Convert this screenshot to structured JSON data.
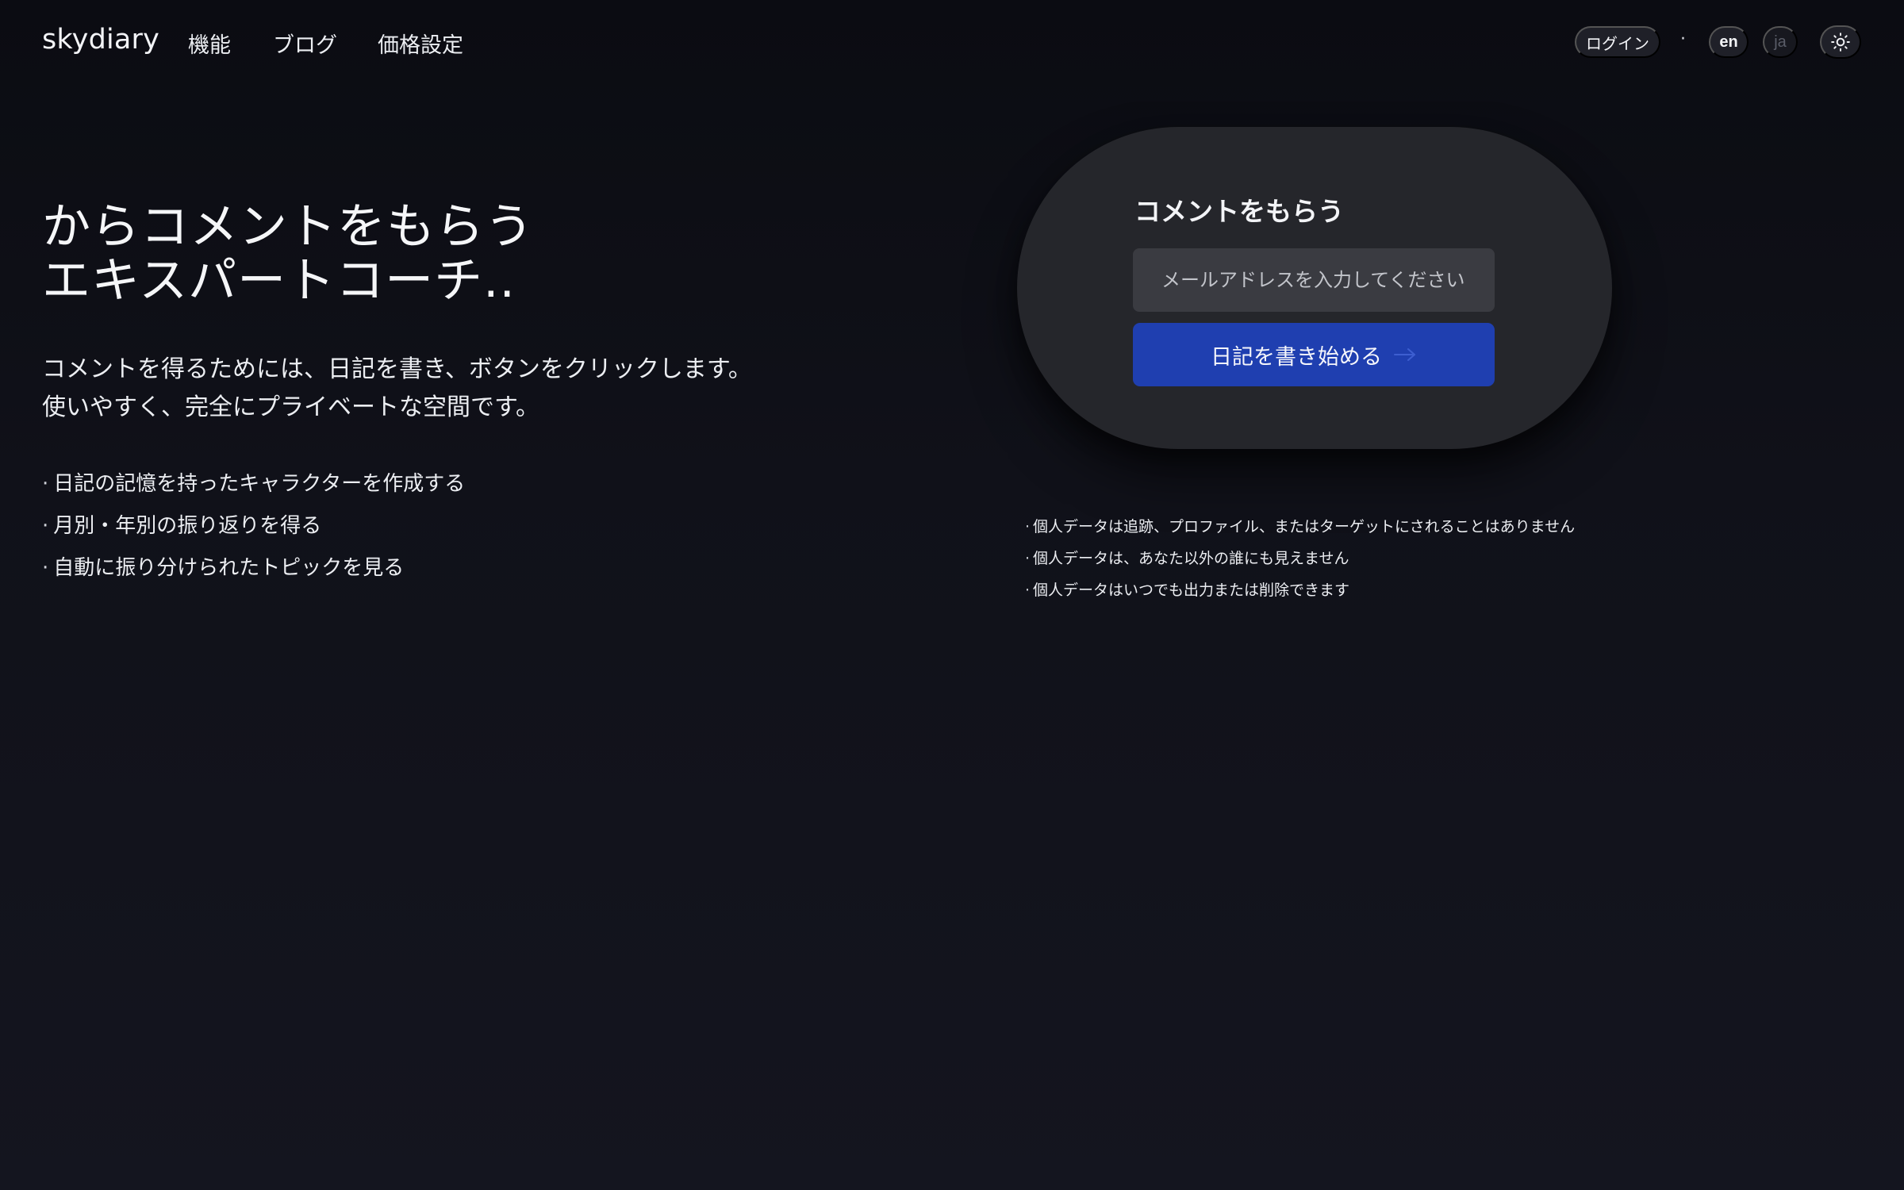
{
  "header": {
    "brand": "skydiary",
    "nav": {
      "features": "機能",
      "blog": "ブログ",
      "pricing": "価格設定"
    },
    "login": "ログイン",
    "separator": "·",
    "lang_en": "en",
    "lang_ja": "ja",
    "theme_icon": "sun-icon"
  },
  "hero": {
    "title_line1": "からコメントをもらう",
    "title_line2": "エキスパートコーチ..",
    "desc_line1": "コメントを得るためには、日記を書き、ボタンをクリックします。",
    "desc_line2": "使いやすく、完全にプライベートな空間です。",
    "bullet": "·",
    "features": [
      "日記の記憶を持ったキャラクターを作成する",
      "月別・年別の振り返りを得る",
      "自動に振り分けられたトピックを見る"
    ]
  },
  "signup": {
    "title": "コメントをもらう",
    "email_placeholder": "メールアドレスを入力してください",
    "email_value": "",
    "button_label": "日記を書き始める",
    "button_icon": "arrow-right-icon",
    "button_color": "#1f3fb0"
  },
  "privacy": {
    "bullet": "·",
    "items": [
      "個人データは追跡、プロファイル、またはターゲットにされることはありません",
      "個人データは、あなた以外の誰にも見えません",
      "個人データはいつでも出力または削除できます"
    ]
  },
  "colors": {
    "background": "#0f1017",
    "card": "#25262b",
    "input": "#3a3b41",
    "accent": "#1f3fb0"
  }
}
